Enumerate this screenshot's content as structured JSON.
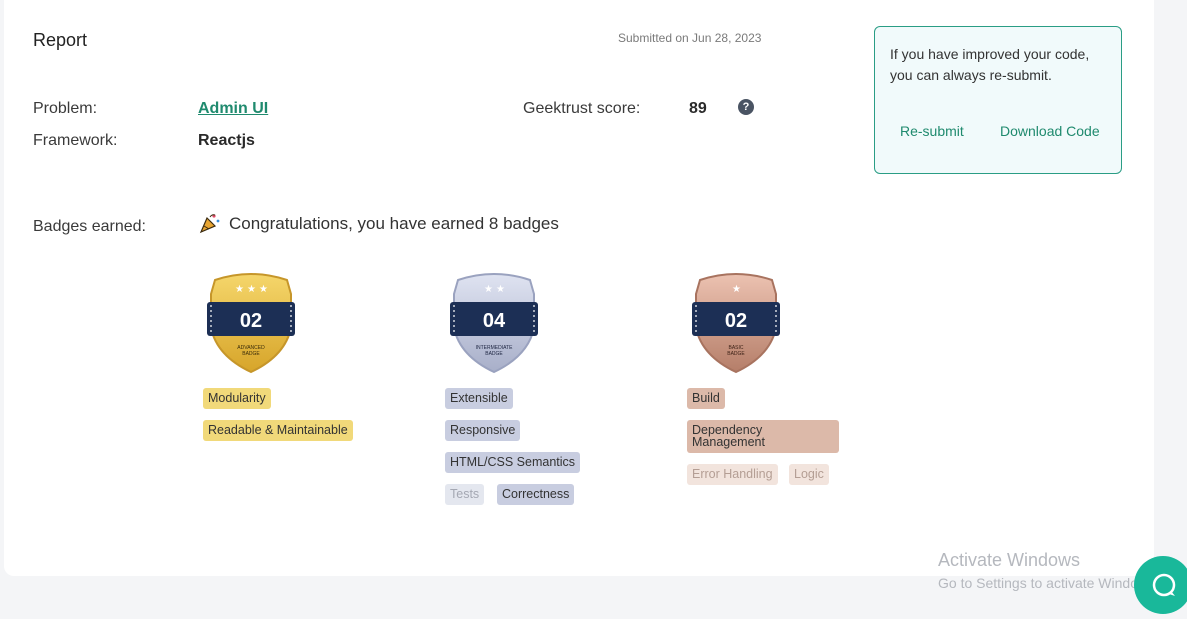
{
  "report": {
    "title": "Report",
    "submitted": "Submitted on Jun 28, 2023",
    "problem_label": "Problem:",
    "problem_value": "Admin UI",
    "framework_label": "Framework:",
    "framework_value": "Reactjs",
    "score_label": "Geektrust score:",
    "score_value": "89",
    "help_glyph": "?"
  },
  "resubmit": {
    "text": "If you have improved your code, you can always re-submit.",
    "resubmit_label": "Re-submit",
    "download_label": "Download Code"
  },
  "badges": {
    "label": "Badges earned:",
    "congrats": "Congratulations, you have earned 8 badges",
    "groups": [
      {
        "tier": "gold",
        "count": "02",
        "caption_line1": "ADVANCED",
        "caption_line2": "BADGE",
        "stars": 3,
        "skills": [
          "Modularity",
          "Readable & Maintainable"
        ]
      },
      {
        "tier": "silver",
        "count": "04",
        "caption_line1": "INTERMEDIATE",
        "caption_line2": "BADGE",
        "stars": 2,
        "skills": [
          "Extensible",
          "Responsive",
          "HTML/CSS Semantics",
          "Tests",
          "Correctness"
        ]
      },
      {
        "tier": "bronze",
        "count": "02",
        "caption_line1": "BASIC",
        "caption_line2": "BADGE",
        "stars": 1,
        "skills": [
          "Build",
          "Dependency Management",
          "Error Handling",
          "Logic"
        ]
      }
    ]
  },
  "watermark": {
    "line1": "Activate Windows",
    "line2": "Go to Settings to activate Windows."
  },
  "colors": {
    "accent": "#1f8a6e",
    "gold": "#e9be3f",
    "silver": "#b7bdd6",
    "bronze": "#c99a86",
    "navy": "#1c2f55"
  },
  "icons": [
    "party-popper-icon",
    "help-icon",
    "chat-icon"
  ]
}
